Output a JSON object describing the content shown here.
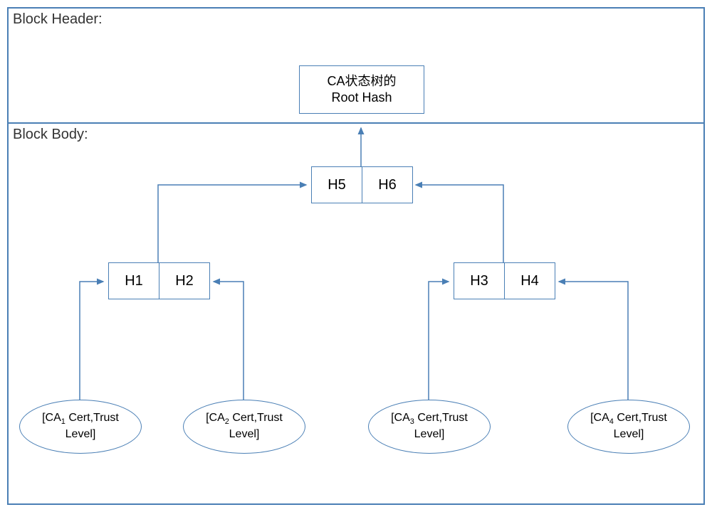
{
  "header": {
    "label": "Block Header:",
    "root": {
      "line1": "CA状态树的",
      "line2": "Root Hash"
    }
  },
  "body": {
    "label": "Block Body:",
    "level2": {
      "left": "H5",
      "right": "H6"
    },
    "level1a": {
      "left": "H1",
      "right": "H2"
    },
    "level1b": {
      "left": "H3",
      "right": "H4"
    },
    "leaves": {
      "ca1": {
        "sub": "1",
        "prefix": "[CA",
        "suffix": " Cert,Trust",
        "line2": "Level]"
      },
      "ca2": {
        "sub": "2",
        "prefix": "[CA",
        "suffix": " Cert,Trust",
        "line2": "Level]"
      },
      "ca3": {
        "sub": "3",
        "prefix": "[CA",
        "suffix": " Cert,Trust",
        "line2": "Level]"
      },
      "ca4": {
        "sub": "4",
        "prefix": "[CA",
        "suffix": " Cert,Trust",
        "line2": "Level]"
      }
    }
  },
  "colors": {
    "border": "#4a7fb5"
  }
}
